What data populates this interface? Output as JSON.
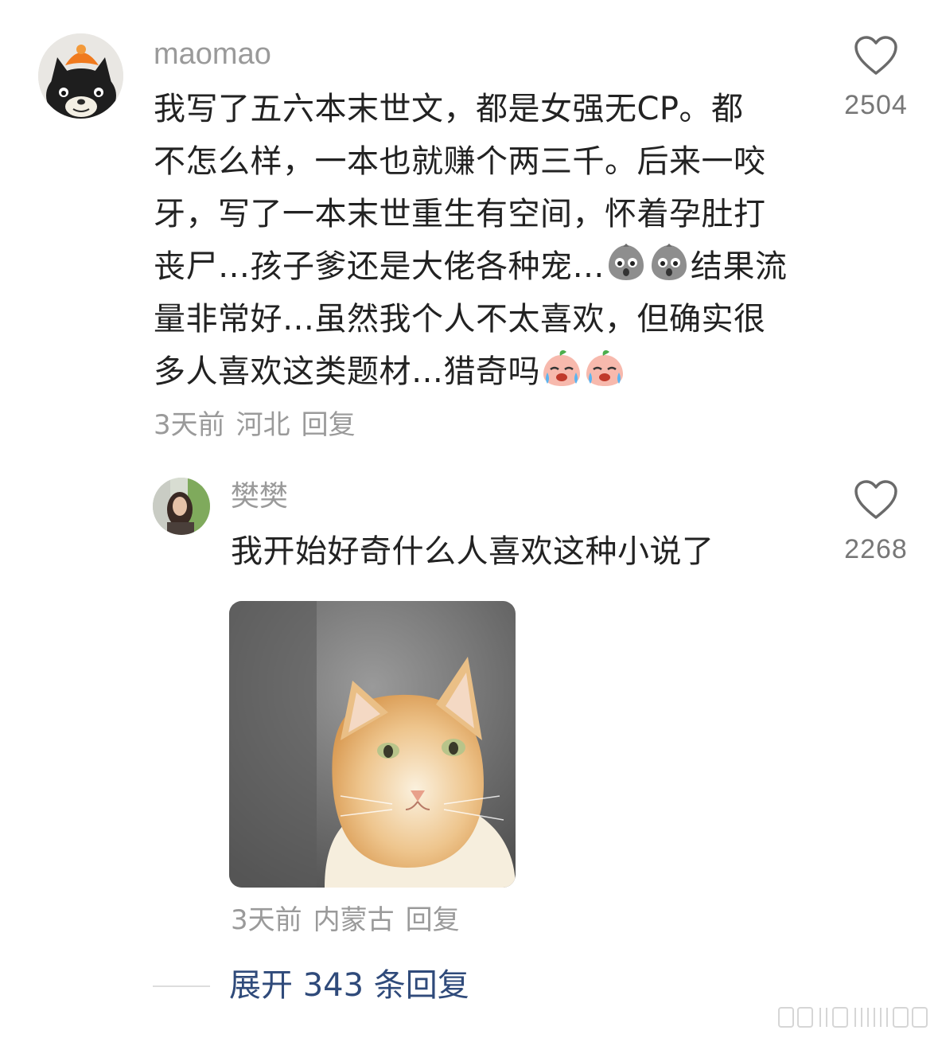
{
  "comment": {
    "author": "maomao",
    "text_line1": "我写了五六本末世文，都是女强无CP。都",
    "text_line2": "不怎么样，一本也就赚个两三千。后来一咬",
    "text_line3": "牙，写了一本末世重生有空间，怀着孕肚打",
    "text_line4a": "丧尸…孩子爹还是大佬各种宠…",
    "text_line4b": "结果流",
    "text_line5": "量非常好…虽然我个人不太喜欢，但确实很",
    "text_line6": "多人喜欢这类题材…猎奇吗",
    "time": "3天前",
    "location": "河北",
    "reply_label": "回复",
    "like_count": "2504",
    "emojis": [
      "rock-face-emoji",
      "rock-face-emoji",
      "crying-peach-emoji",
      "crying-peach-emoji"
    ]
  },
  "reply": {
    "author": "樊樊",
    "text": "我开始好奇什么人喜欢这种小说了",
    "image": "ginger-cat-photo",
    "time": "3天前",
    "location": "内蒙古",
    "reply_label": "回复",
    "like_count": "2268"
  },
  "expand": {
    "label": "展开 343 条回复"
  },
  "colors": {
    "text": "#222222",
    "muted": "#9a9a9a",
    "link": "#2f4a7a",
    "like_icon": "#6a6a6a"
  }
}
